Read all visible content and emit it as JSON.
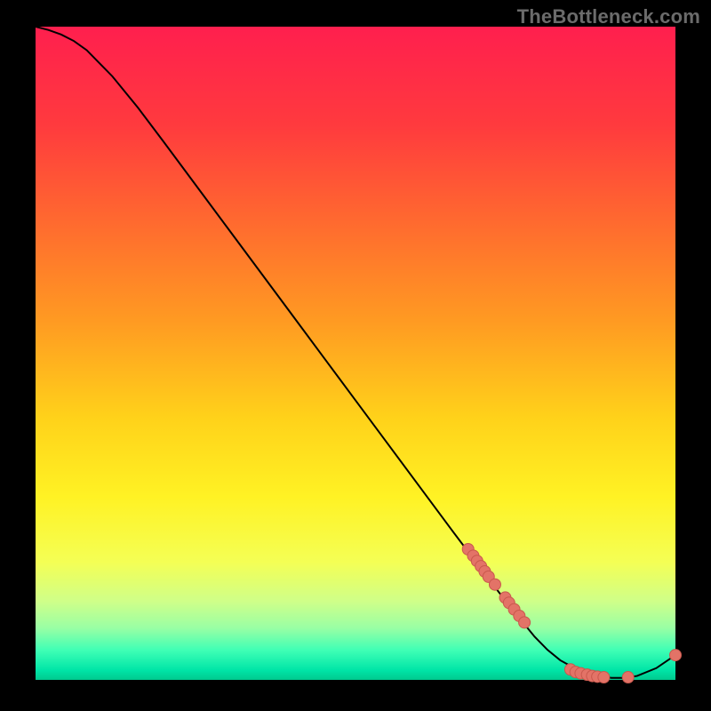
{
  "watermark": "TheBottleneck.com",
  "colors": {
    "black": "#000000",
    "curve": "#000000",
    "marker_fill": "#e37367",
    "marker_stroke": "#c9584d"
  },
  "chart_data": {
    "type": "line",
    "title": "",
    "xlabel": "",
    "ylabel": "",
    "xlim": [
      0,
      100
    ],
    "ylim": [
      0,
      100
    ],
    "grid": false,
    "legend": false,
    "background_gradient": {
      "type": "vertical",
      "stops": [
        {
          "t": 0.0,
          "color": "#ff1f4e"
        },
        {
          "t": 0.15,
          "color": "#ff3a3e"
        },
        {
          "t": 0.3,
          "color": "#ff6a2f"
        },
        {
          "t": 0.45,
          "color": "#ff9a22"
        },
        {
          "t": 0.6,
          "color": "#ffd21a"
        },
        {
          "t": 0.72,
          "color": "#fff224"
        },
        {
          "t": 0.82,
          "color": "#f4ff55"
        },
        {
          "t": 0.88,
          "color": "#cfff89"
        },
        {
          "t": 0.92,
          "color": "#9affa4"
        },
        {
          "t": 0.955,
          "color": "#3effb5"
        },
        {
          "t": 0.985,
          "color": "#00e5a7"
        },
        {
          "t": 1.0,
          "color": "#00c98e"
        }
      ]
    },
    "series": [
      {
        "name": "bottleneck-curve",
        "x": [
          0,
          2,
          4,
          6,
          8,
          10,
          12,
          14,
          16,
          20,
          25,
          30,
          35,
          40,
          45,
          50,
          55,
          60,
          65,
          70,
          74,
          78,
          80,
          82,
          85,
          88,
          90,
          92,
          94,
          97,
          100
        ],
        "y": [
          100,
          99.5,
          98.8,
          97.8,
          96.4,
          94.4,
          92.4,
          90.0,
          87.6,
          82.4,
          75.8,
          69.2,
          62.6,
          56.0,
          49.4,
          42.8,
          36.2,
          29.6,
          23.0,
          16.5,
          11.4,
          6.6,
          4.6,
          3.0,
          1.4,
          0.6,
          0.3,
          0.3,
          0.6,
          1.8,
          3.8
        ]
      }
    ],
    "marker_clusters": [
      {
        "name": "upper-band-cluster",
        "points": [
          {
            "x": 67.6,
            "y": 20.0
          },
          {
            "x": 68.4,
            "y": 19.0
          },
          {
            "x": 69.0,
            "y": 18.2
          },
          {
            "x": 69.6,
            "y": 17.4
          },
          {
            "x": 70.2,
            "y": 16.6
          },
          {
            "x": 70.8,
            "y": 15.8
          },
          {
            "x": 71.8,
            "y": 14.6
          }
        ]
      },
      {
        "name": "mid-band-cluster",
        "points": [
          {
            "x": 73.4,
            "y": 12.6
          },
          {
            "x": 74.0,
            "y": 11.8
          },
          {
            "x": 74.8,
            "y": 10.8
          },
          {
            "x": 75.6,
            "y": 9.8
          },
          {
            "x": 76.4,
            "y": 8.8
          }
        ]
      },
      {
        "name": "floor-cluster-left",
        "points": [
          {
            "x": 83.6,
            "y": 1.6
          },
          {
            "x": 84.4,
            "y": 1.2
          },
          {
            "x": 85.2,
            "y": 1.0
          },
          {
            "x": 86.2,
            "y": 0.8
          },
          {
            "x": 87.0,
            "y": 0.6
          },
          {
            "x": 87.8,
            "y": 0.5
          },
          {
            "x": 88.8,
            "y": 0.4
          }
        ]
      },
      {
        "name": "floor-cluster-right",
        "points": [
          {
            "x": 92.6,
            "y": 0.4
          }
        ]
      },
      {
        "name": "end-marker",
        "points": [
          {
            "x": 100.0,
            "y": 3.8
          }
        ]
      }
    ]
  }
}
